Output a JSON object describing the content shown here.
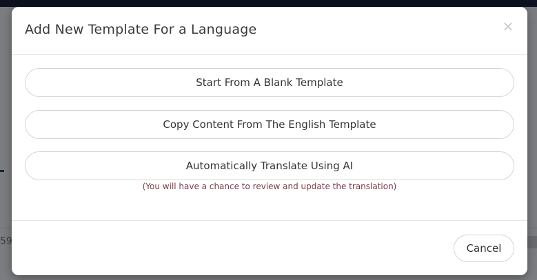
{
  "background": {
    "partial_text": "59"
  },
  "modal": {
    "title": "Add New Template For a Language",
    "close_symbol": "×",
    "options": [
      {
        "label": "Start From A Blank Template"
      },
      {
        "label": "Copy Content From The English Template"
      },
      {
        "label": "Automatically Translate Using AI"
      }
    ],
    "hint": "(You will have a chance to review and update the translation)",
    "cancel_label": "Cancel"
  },
  "colors": {
    "hint_text": "#7a3945",
    "overlay": "#7c7d80",
    "topbar": "#0d1220"
  }
}
